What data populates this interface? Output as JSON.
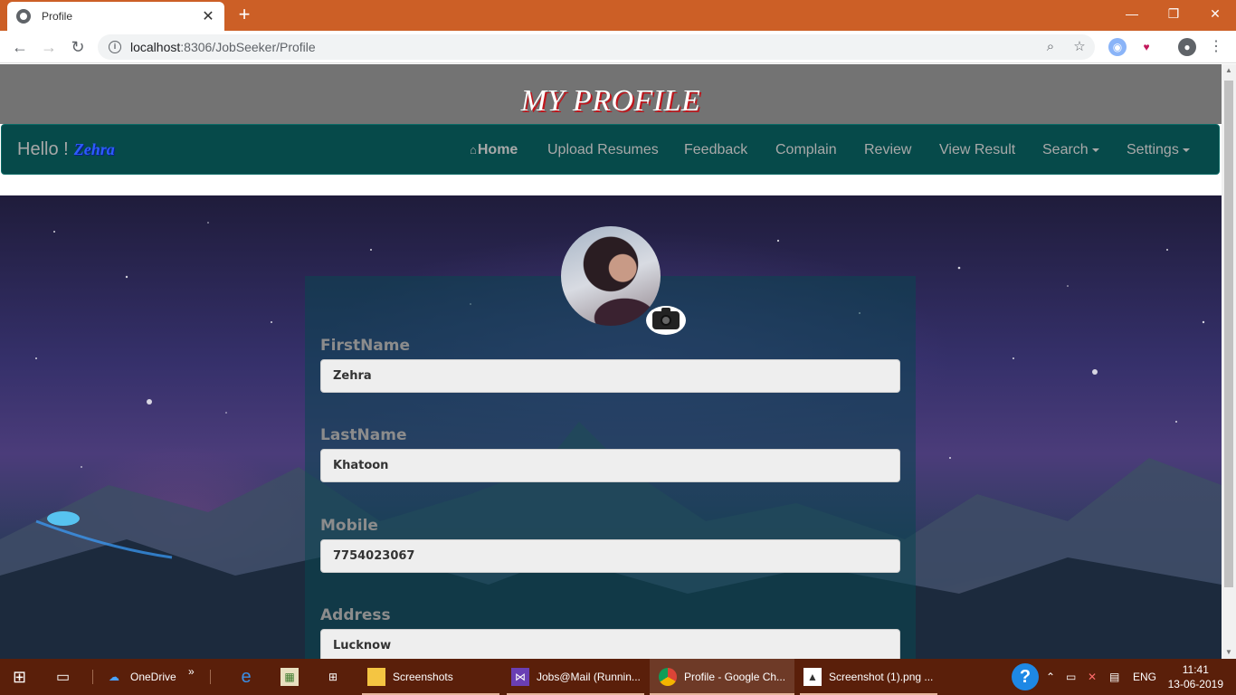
{
  "browser": {
    "tab_title": "Profile",
    "tab_close": "✕",
    "new_tab": "+",
    "url_host": "localhost",
    "url_path": ":8306/JobSeeker/Profile",
    "window_controls": {
      "minimize": "—",
      "restore": "❐",
      "close": "✕"
    }
  },
  "page": {
    "header_title": "MY PROFILE",
    "hello_prefix": "Hello !",
    "hello_name": "Zehra",
    "nav": {
      "home": "Home",
      "upload_resumes": "Upload Resumes",
      "feedback": "Feedback",
      "complain": "Complain",
      "review": "Review",
      "view_result": "View Result",
      "search": "Search",
      "settings": "Settings"
    },
    "form": {
      "firstname_label": "FirstName",
      "firstname_value": "Zehra",
      "lastname_label": "LastName",
      "lastname_value": "Khatoon",
      "mobile_label": "Mobile",
      "mobile_value": "7754023067",
      "address_label": "Address",
      "address_value": "Lucknow"
    }
  },
  "taskbar": {
    "onedrive": "OneDrive",
    "chevron": "»",
    "screenshots": "Screenshots",
    "jobsmail": "Jobs@Mail (Runnin...",
    "chrome_profile": "Profile - Google Ch...",
    "screenshot_png": "Screenshot (1).png ...",
    "lang": "ENG",
    "time": "11:41",
    "date": "13-06-2019"
  },
  "colors": {
    "tabbar": "#cc5f26",
    "header_band": "#737373",
    "navbar": "#064a4a",
    "title_shadow": "#c0161c",
    "taskbar": "#5a1f0a"
  }
}
